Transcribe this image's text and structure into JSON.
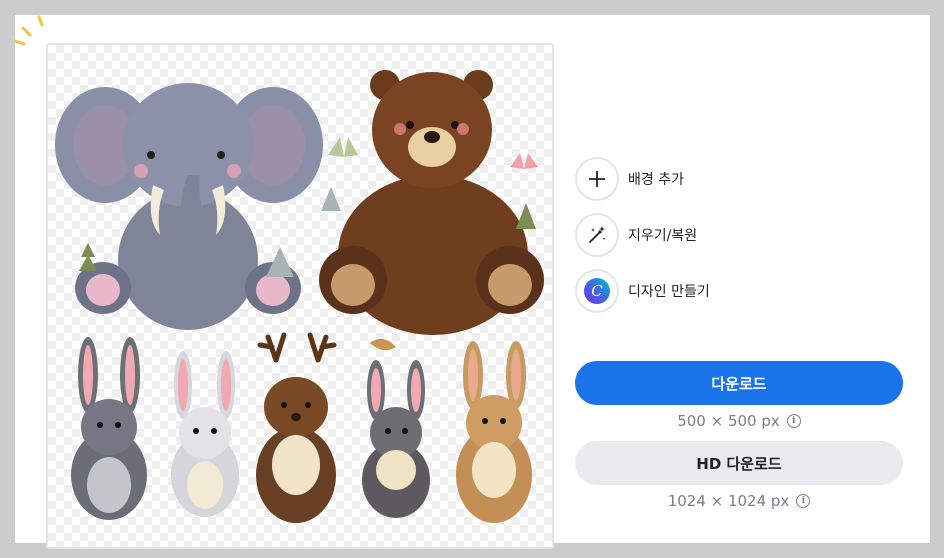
{
  "tools": [
    {
      "label": "배경 추가",
      "icon": "plus-icon"
    },
    {
      "label": "지우기/복원",
      "icon": "magic-wand-icon"
    },
    {
      "label": "디자인 만들기",
      "icon": "canva-logo-icon"
    }
  ],
  "download": {
    "label": "다운로드",
    "size": "500 × 500 px",
    "info_icon": "info-icon"
  },
  "hd_download": {
    "label": "HD 다운로드",
    "size": "1024 × 1024 px",
    "info_icon": "info-icon"
  },
  "colors": {
    "primary_button": "#1a73e8",
    "secondary_button": "#e8ecf0",
    "page_background": "#cccccc"
  },
  "preview": {
    "content": "illustration of cartoon animals on transparent background",
    "animals": [
      "elephant",
      "bear",
      "rabbit",
      "rabbit",
      "deer",
      "rabbit",
      "rabbit"
    ]
  }
}
